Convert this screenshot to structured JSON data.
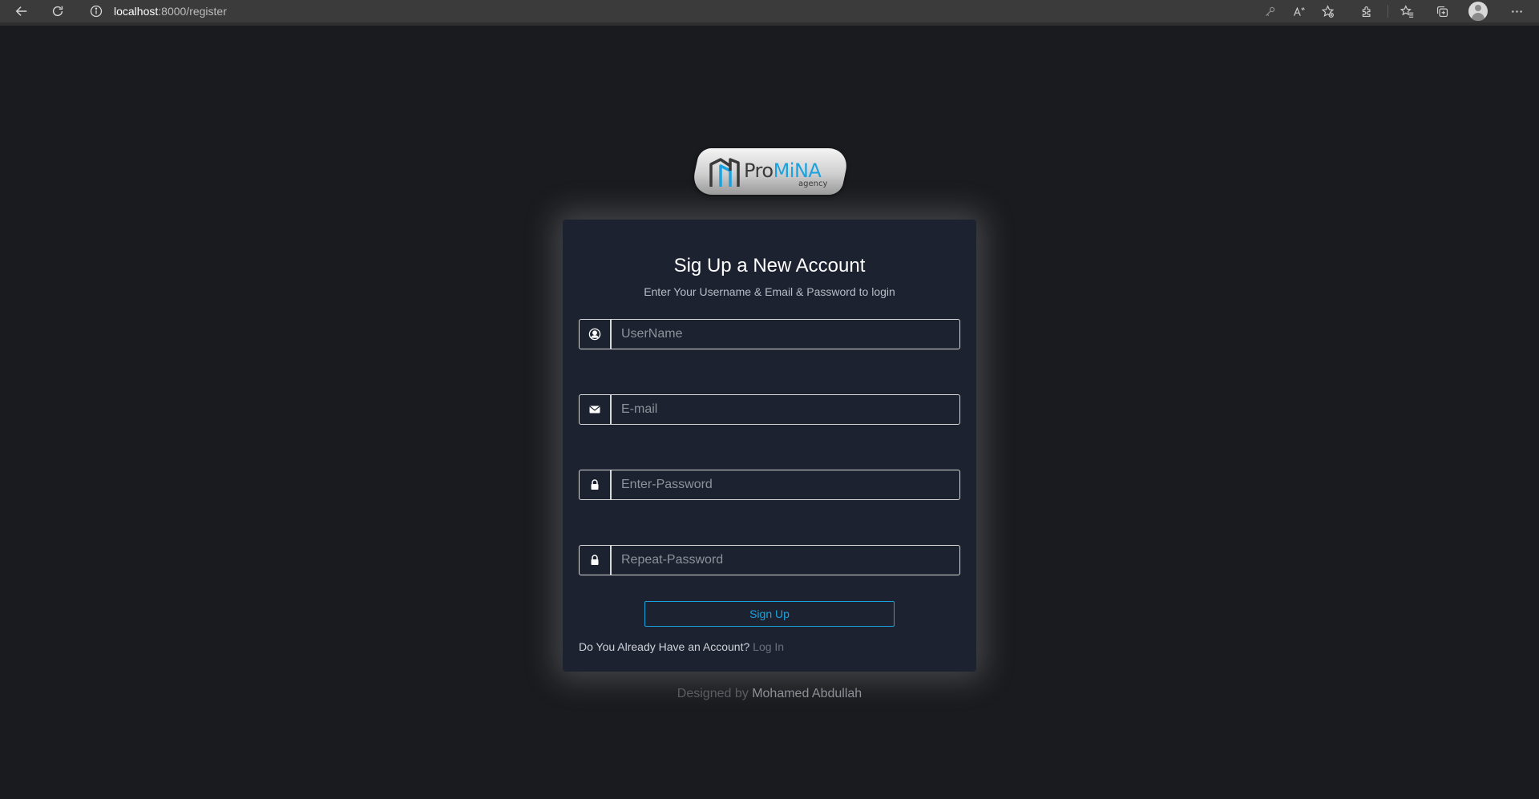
{
  "browser": {
    "url_host": "localhost",
    "url_path": ":8000/register",
    "nav_icons": [
      "back-arrow-icon",
      "reload-icon"
    ],
    "toolbar_icons": [
      "key-icon",
      "read-aloud-icon",
      "add-favorite-icon",
      "extensions-icon",
      "favorites-icon",
      "collections-icon",
      "profile-icon",
      "more-icon"
    ]
  },
  "logo": {
    "pro": "Pro",
    "mina": "MiNA",
    "sub": "agency",
    "colors": {
      "accent": "#1aa3e0",
      "dark": "#3a3a3a"
    }
  },
  "card": {
    "title": "Sig Up a New Account",
    "subtitle": "Enter Your Username & Email & Password to login",
    "fields": [
      {
        "icon": "user-circle-icon",
        "placeholder": "UserName",
        "value": ""
      },
      {
        "icon": "envelope-icon",
        "placeholder": "E-mail",
        "value": ""
      },
      {
        "icon": "lock-icon",
        "placeholder": "Enter-Password",
        "value": ""
      },
      {
        "icon": "lock-icon",
        "placeholder": "Repeat-Password",
        "value": ""
      }
    ],
    "submit_label": "Sign Up",
    "login_prompt": "Do You Already Have an Account?",
    "login_link": "Log In"
  },
  "footer": {
    "designed_by": "Designed by",
    "author": "Mohamed Abdullah"
  },
  "colors": {
    "page_bg": "#1a1b1f",
    "card_bg": "#1d2230",
    "accent": "#1aa3e0"
  }
}
